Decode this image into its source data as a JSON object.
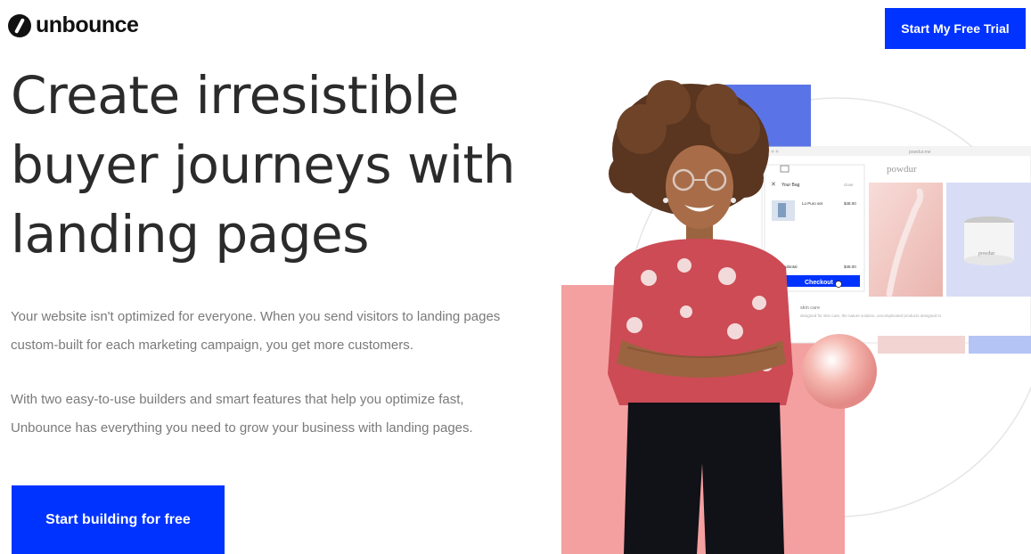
{
  "header": {
    "logo_text": "unbounce",
    "trial_button": "Start My Free Trial"
  },
  "hero": {
    "headline": "Create irresistible buyer journeys with landing pages",
    "paragraph_1": "Your website isn't optimized for everyone. When you send visitors to landing pages custom-built for each marketing campaign, you get more customers.",
    "paragraph_2": "With two easy-to-use builders and smart features that help you optimize fast, Unbounce has everything you need to grow your business with landing pages.",
    "cta_button": "Start building for free"
  },
  "mockup": {
    "brand": "powdur",
    "url": "powdur.me",
    "bag_title": "Your Bag",
    "bag_close": "close",
    "item_name": "Lo Puro set",
    "item_price": "$48.00",
    "subtotal_label": "Subtotal",
    "subtotal_value": "$48.00",
    "checkout_button": "Checkout",
    "jar_label": "powdur",
    "caption_title": "skin care",
    "caption_text": "designed for skin care, the nature solution, uncomplicated products designed to"
  },
  "colors": {
    "accent": "#0033ff",
    "salmon": "#f4a0a0",
    "periwinkle": "#5a74e8"
  }
}
